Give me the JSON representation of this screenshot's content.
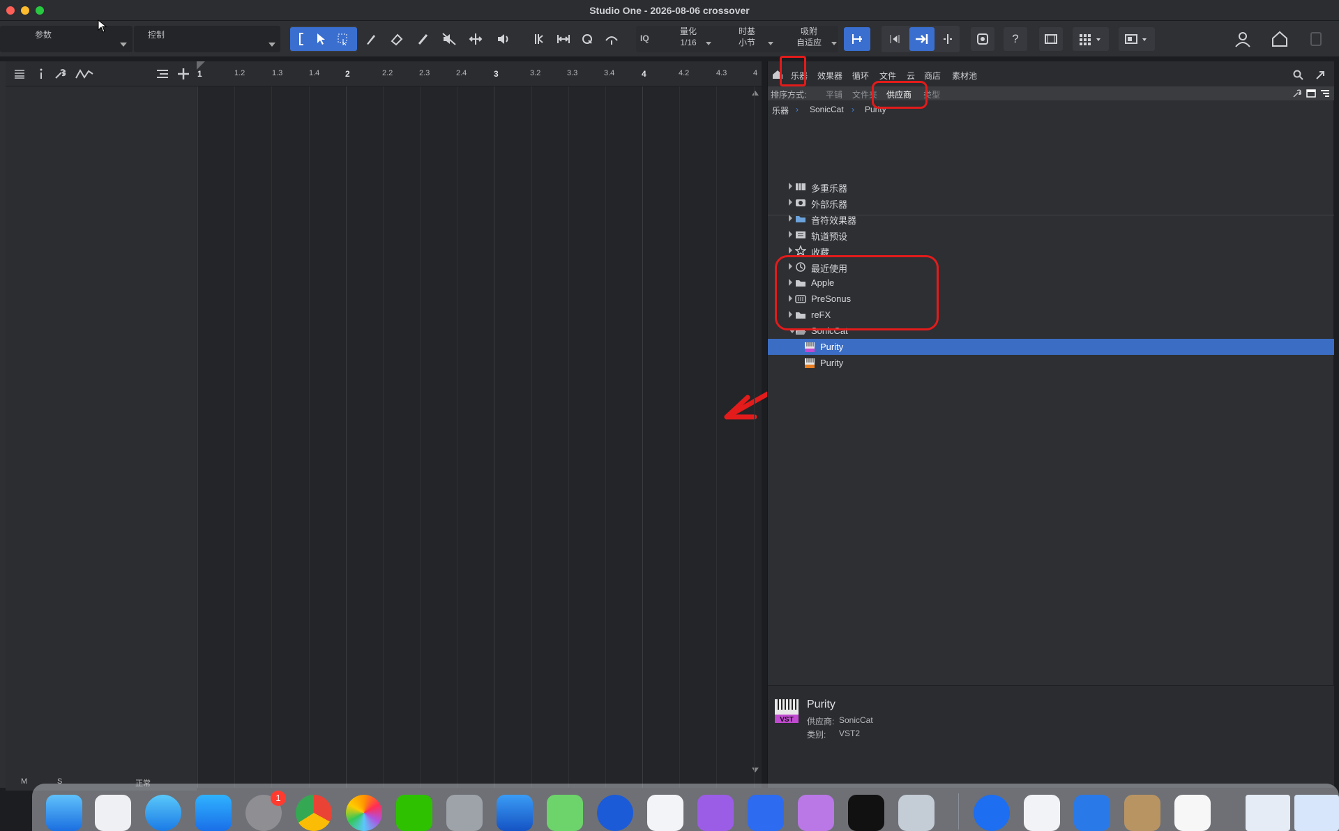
{
  "window": {
    "title": "Studio One - 2026-08-06 crossover"
  },
  "toolbar": {
    "param_label": "参数",
    "control_label": "控制",
    "iq_label": "IQ",
    "quantize_label": "量化",
    "quantize_value": "1/16",
    "timebase_label": "时基",
    "timebase_value": "小节",
    "snap_label": "吸附",
    "snap_value": "自适应",
    "help_label": "?"
  },
  "ruler": {
    "labels": [
      "1",
      "1.2",
      "1.3",
      "1.4",
      "2",
      "2.2",
      "2.3",
      "2.4",
      "3",
      "3.2",
      "3.3",
      "3.4",
      "4",
      "4.2",
      "4.3",
      "4"
    ]
  },
  "left_panel": {
    "foot_m": "M",
    "foot_s": "S",
    "foot_mode": "正常"
  },
  "browser": {
    "tabs": [
      "乐器",
      "效果器",
      "循环",
      "文件",
      "云",
      "商店",
      "素材池"
    ],
    "sort": {
      "label": "排序方式:",
      "options": [
        "平铺",
        "文件夹",
        "供应商",
        "类型"
      ],
      "active": "供应商"
    },
    "breadcrumb": [
      "乐器",
      "SonicCat",
      "Purity"
    ],
    "tree": [
      {
        "label": "多重乐器",
        "icon": "multi-instrument-icon"
      },
      {
        "label": "外部乐器",
        "icon": "external-instrument-icon"
      },
      {
        "label": "音符效果器",
        "icon": "note-fx-folder-icon"
      },
      {
        "label": "轨道预设",
        "icon": "track-preset-icon"
      },
      {
        "label": "收藏",
        "icon": "star-icon"
      },
      {
        "label": "最近使用",
        "icon": "clock-icon"
      },
      {
        "label": "Apple",
        "icon": "folder-icon"
      },
      {
        "label": "PreSonus",
        "icon": "presonus-icon"
      },
      {
        "label": "reFX",
        "icon": "folder-icon"
      },
      {
        "label": "SonicCat",
        "icon": "folder-open-icon"
      },
      {
        "label": "Purity",
        "icon": "vst-plugin-icon",
        "selected": true
      },
      {
        "label": "Purity",
        "icon": "au-plugin-icon"
      }
    ],
    "info": {
      "name": "Purity",
      "vendor_label": "供应商:",
      "vendor": "SonicCat",
      "category_label": "类别:",
      "category": "VST2",
      "badge": "VST"
    }
  },
  "notifications": {
    "system_prefs_badge": "1"
  },
  "colors": {
    "accent": "#3a6fd0",
    "selection": "#3b6dc4",
    "annotation": "#e31b1b",
    "badge": "#ff3b30"
  }
}
